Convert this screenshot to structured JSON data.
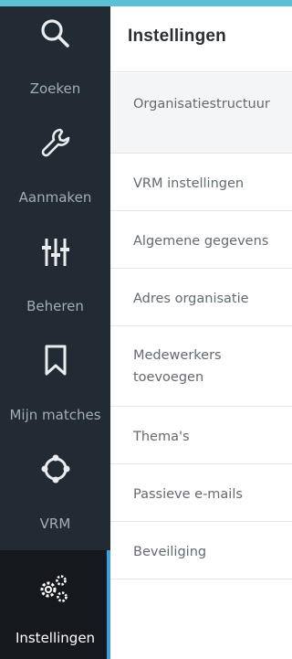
{
  "nav": {
    "items": [
      {
        "label": "Zoeken",
        "icon": "search-icon"
      },
      {
        "label": "Aanmaken",
        "icon": "wrench-icon"
      },
      {
        "label": "Beheren",
        "icon": "sliders-icon"
      },
      {
        "label": "Mijn matches",
        "icon": "bookmark-icon"
      },
      {
        "label": "VRM",
        "icon": "circle-nodes-icon"
      },
      {
        "label": "Instellingen",
        "icon": "gears-icon"
      }
    ],
    "active": "Instellingen",
    "accent_color": "#3aa0e6"
  },
  "panel": {
    "title": "Instellingen",
    "items": [
      {
        "label": "Organisatiestructuur"
      },
      {
        "label": "VRM instellingen"
      },
      {
        "label": "Algemene gegevens"
      },
      {
        "label": "Adres organisatie"
      },
      {
        "label": "Medewerkers toevoegen"
      },
      {
        "label": "Thema's"
      },
      {
        "label": "Passieve e-mails"
      },
      {
        "label": "Beveiliging"
      }
    ]
  },
  "colors": {
    "top_bar": "#5bc0d6",
    "nav_background": "#222b33",
    "nav_active_background": "#15191d"
  }
}
